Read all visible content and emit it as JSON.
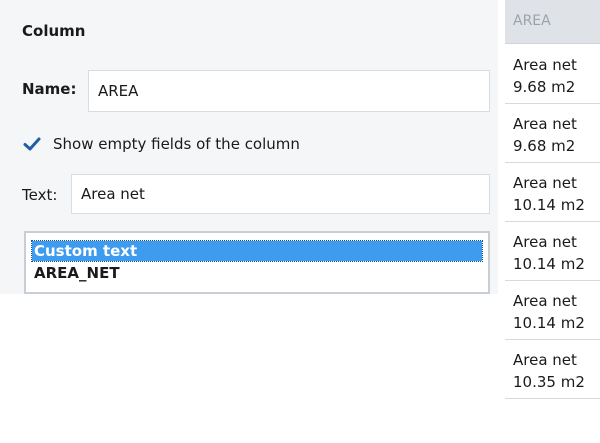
{
  "column_panel": {
    "title": "Column",
    "name_label": "Name:",
    "name_value": "AREA",
    "checkbox_checked": true,
    "checkbox_label": "Show empty fields of the column",
    "text_label": "Text:",
    "text_value": "Area net",
    "list_items": [
      "Custom text",
      "AREA_NET"
    ],
    "selected_index": 0
  },
  "grid": {
    "header": "AREA",
    "rows": [
      {
        "line1": "Area net",
        "line2": "9.68 m2"
      },
      {
        "line1": "Area net",
        "line2": "9.68 m2"
      },
      {
        "line1": "Area net",
        "line2": "10.14 m2"
      },
      {
        "line1": "Area net",
        "line2": "10.14 m2"
      },
      {
        "line1": "Area net",
        "line2": "10.14 m2"
      },
      {
        "line1": "Area net",
        "line2": "10.35 m2"
      }
    ]
  },
  "colors": {
    "accent": "#3d9bf0",
    "panel_bg": "#f5f6f7",
    "check": "#1f5fa8"
  }
}
